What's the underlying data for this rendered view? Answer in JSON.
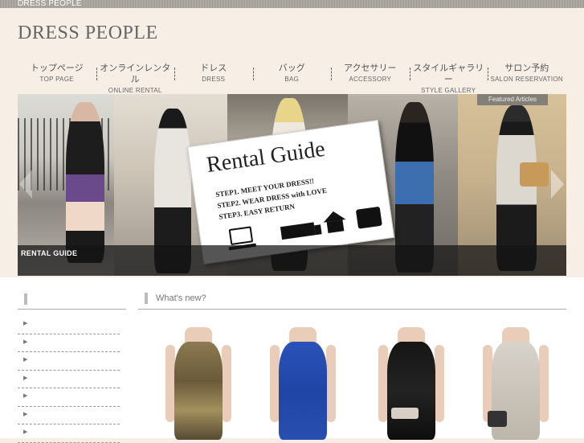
{
  "topbar": {
    "title": "DRESS PEOPLE"
  },
  "header": {
    "logo": "DRESS PEOPLE"
  },
  "nav": {
    "items": [
      {
        "jp": "トップページ",
        "en": "TOP PAGE"
      },
      {
        "jp": "オンラインレンタル",
        "en": "ONLINE RENTAL"
      },
      {
        "jp": "ドレス",
        "en": "DRESS"
      },
      {
        "jp": "バッグ",
        "en": "BAG"
      },
      {
        "jp": "アクセサリー",
        "en": "ACCESSORY"
      },
      {
        "jp": "スタイルギャラリー",
        "en": "STYLE GALLERY"
      },
      {
        "jp": "サロン予約",
        "en": "SALON RESERVATION"
      }
    ]
  },
  "hero": {
    "featured_label": "Featured Articles",
    "caption": "RENTAL GUIDE",
    "card": {
      "title": "Rental Guide",
      "steps": [
        "STEP1. MEET YOUR DRESS!!",
        "STEP2. WEAR DRESS with LOVE",
        "STEP3. EASY RETURN"
      ]
    }
  },
  "main": {
    "section_title": "What's new?"
  },
  "colors": {
    "page_bg": "#f7efe6",
    "content_bg": "#ffffff",
    "caption_bg": "#141414"
  }
}
